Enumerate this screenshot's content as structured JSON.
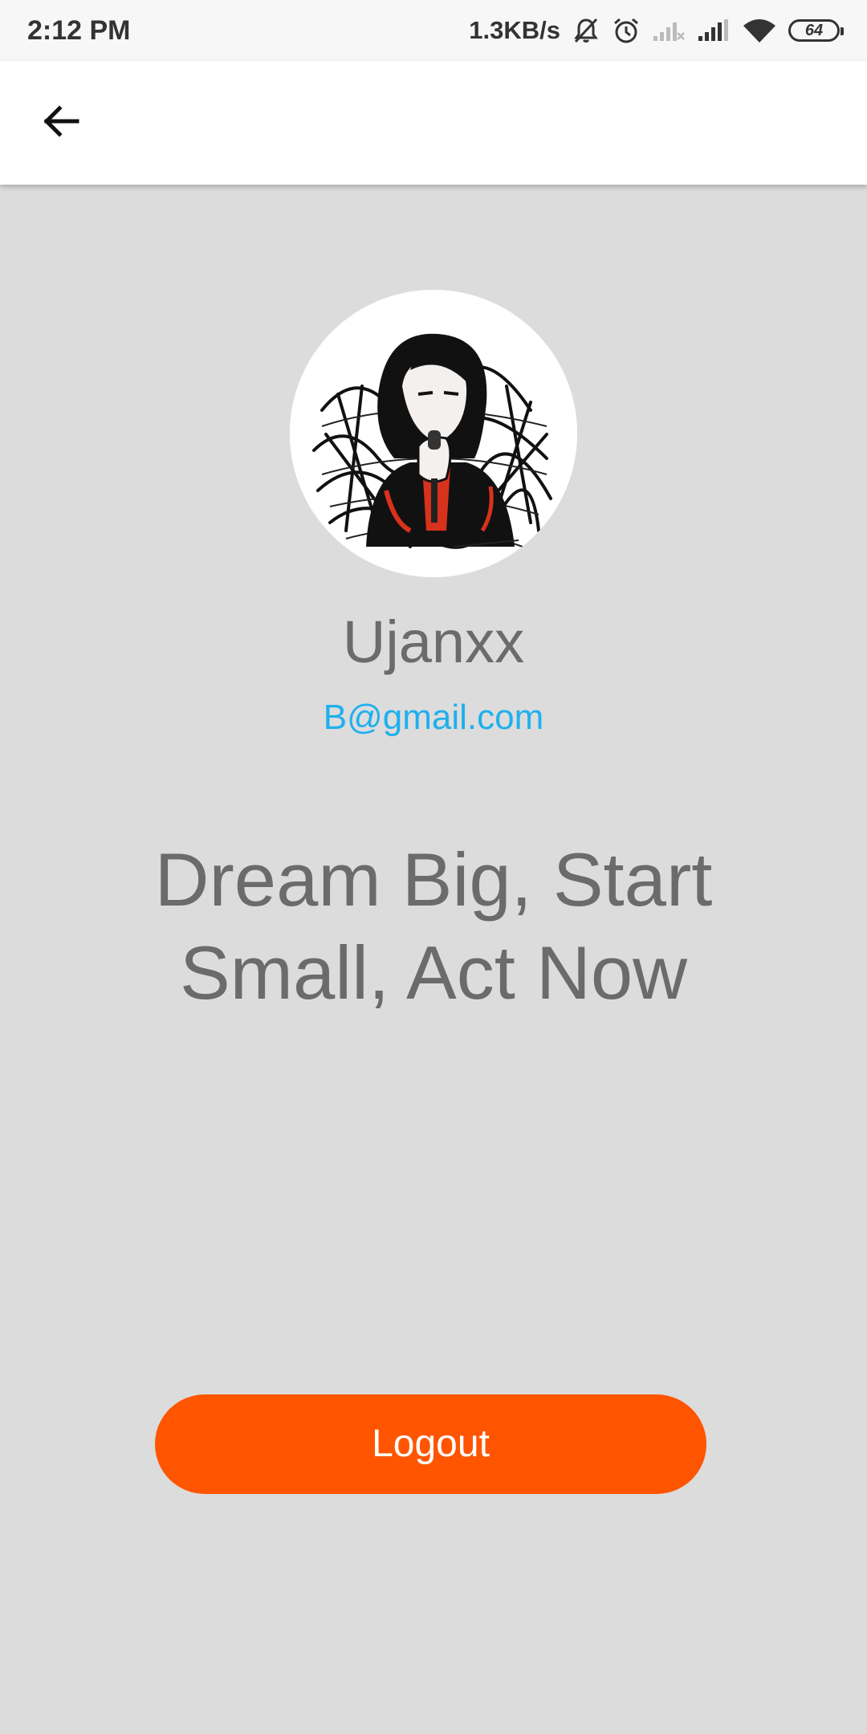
{
  "status_bar": {
    "time": "2:12 PM",
    "net_speed": "1.3KB/s",
    "battery_level": "64",
    "icons": [
      "mute-bell-icon",
      "alarm-icon",
      "signal-weak-icon",
      "signal-icon",
      "wifi-icon",
      "battery-icon"
    ]
  },
  "app_bar": {
    "back_icon": "arrow-left-icon"
  },
  "profile": {
    "avatar": "illustrated-portrait",
    "name": "Ujanxx",
    "email": "B@gmail.com",
    "quote": "Dream Big, Start Small, Act Now"
  },
  "actions": {
    "logout_label": "Logout"
  },
  "colors": {
    "background": "#dcdcdc",
    "accent": "#ff5500",
    "email": "#1eb0ee",
    "text": "#6b6b6b"
  }
}
